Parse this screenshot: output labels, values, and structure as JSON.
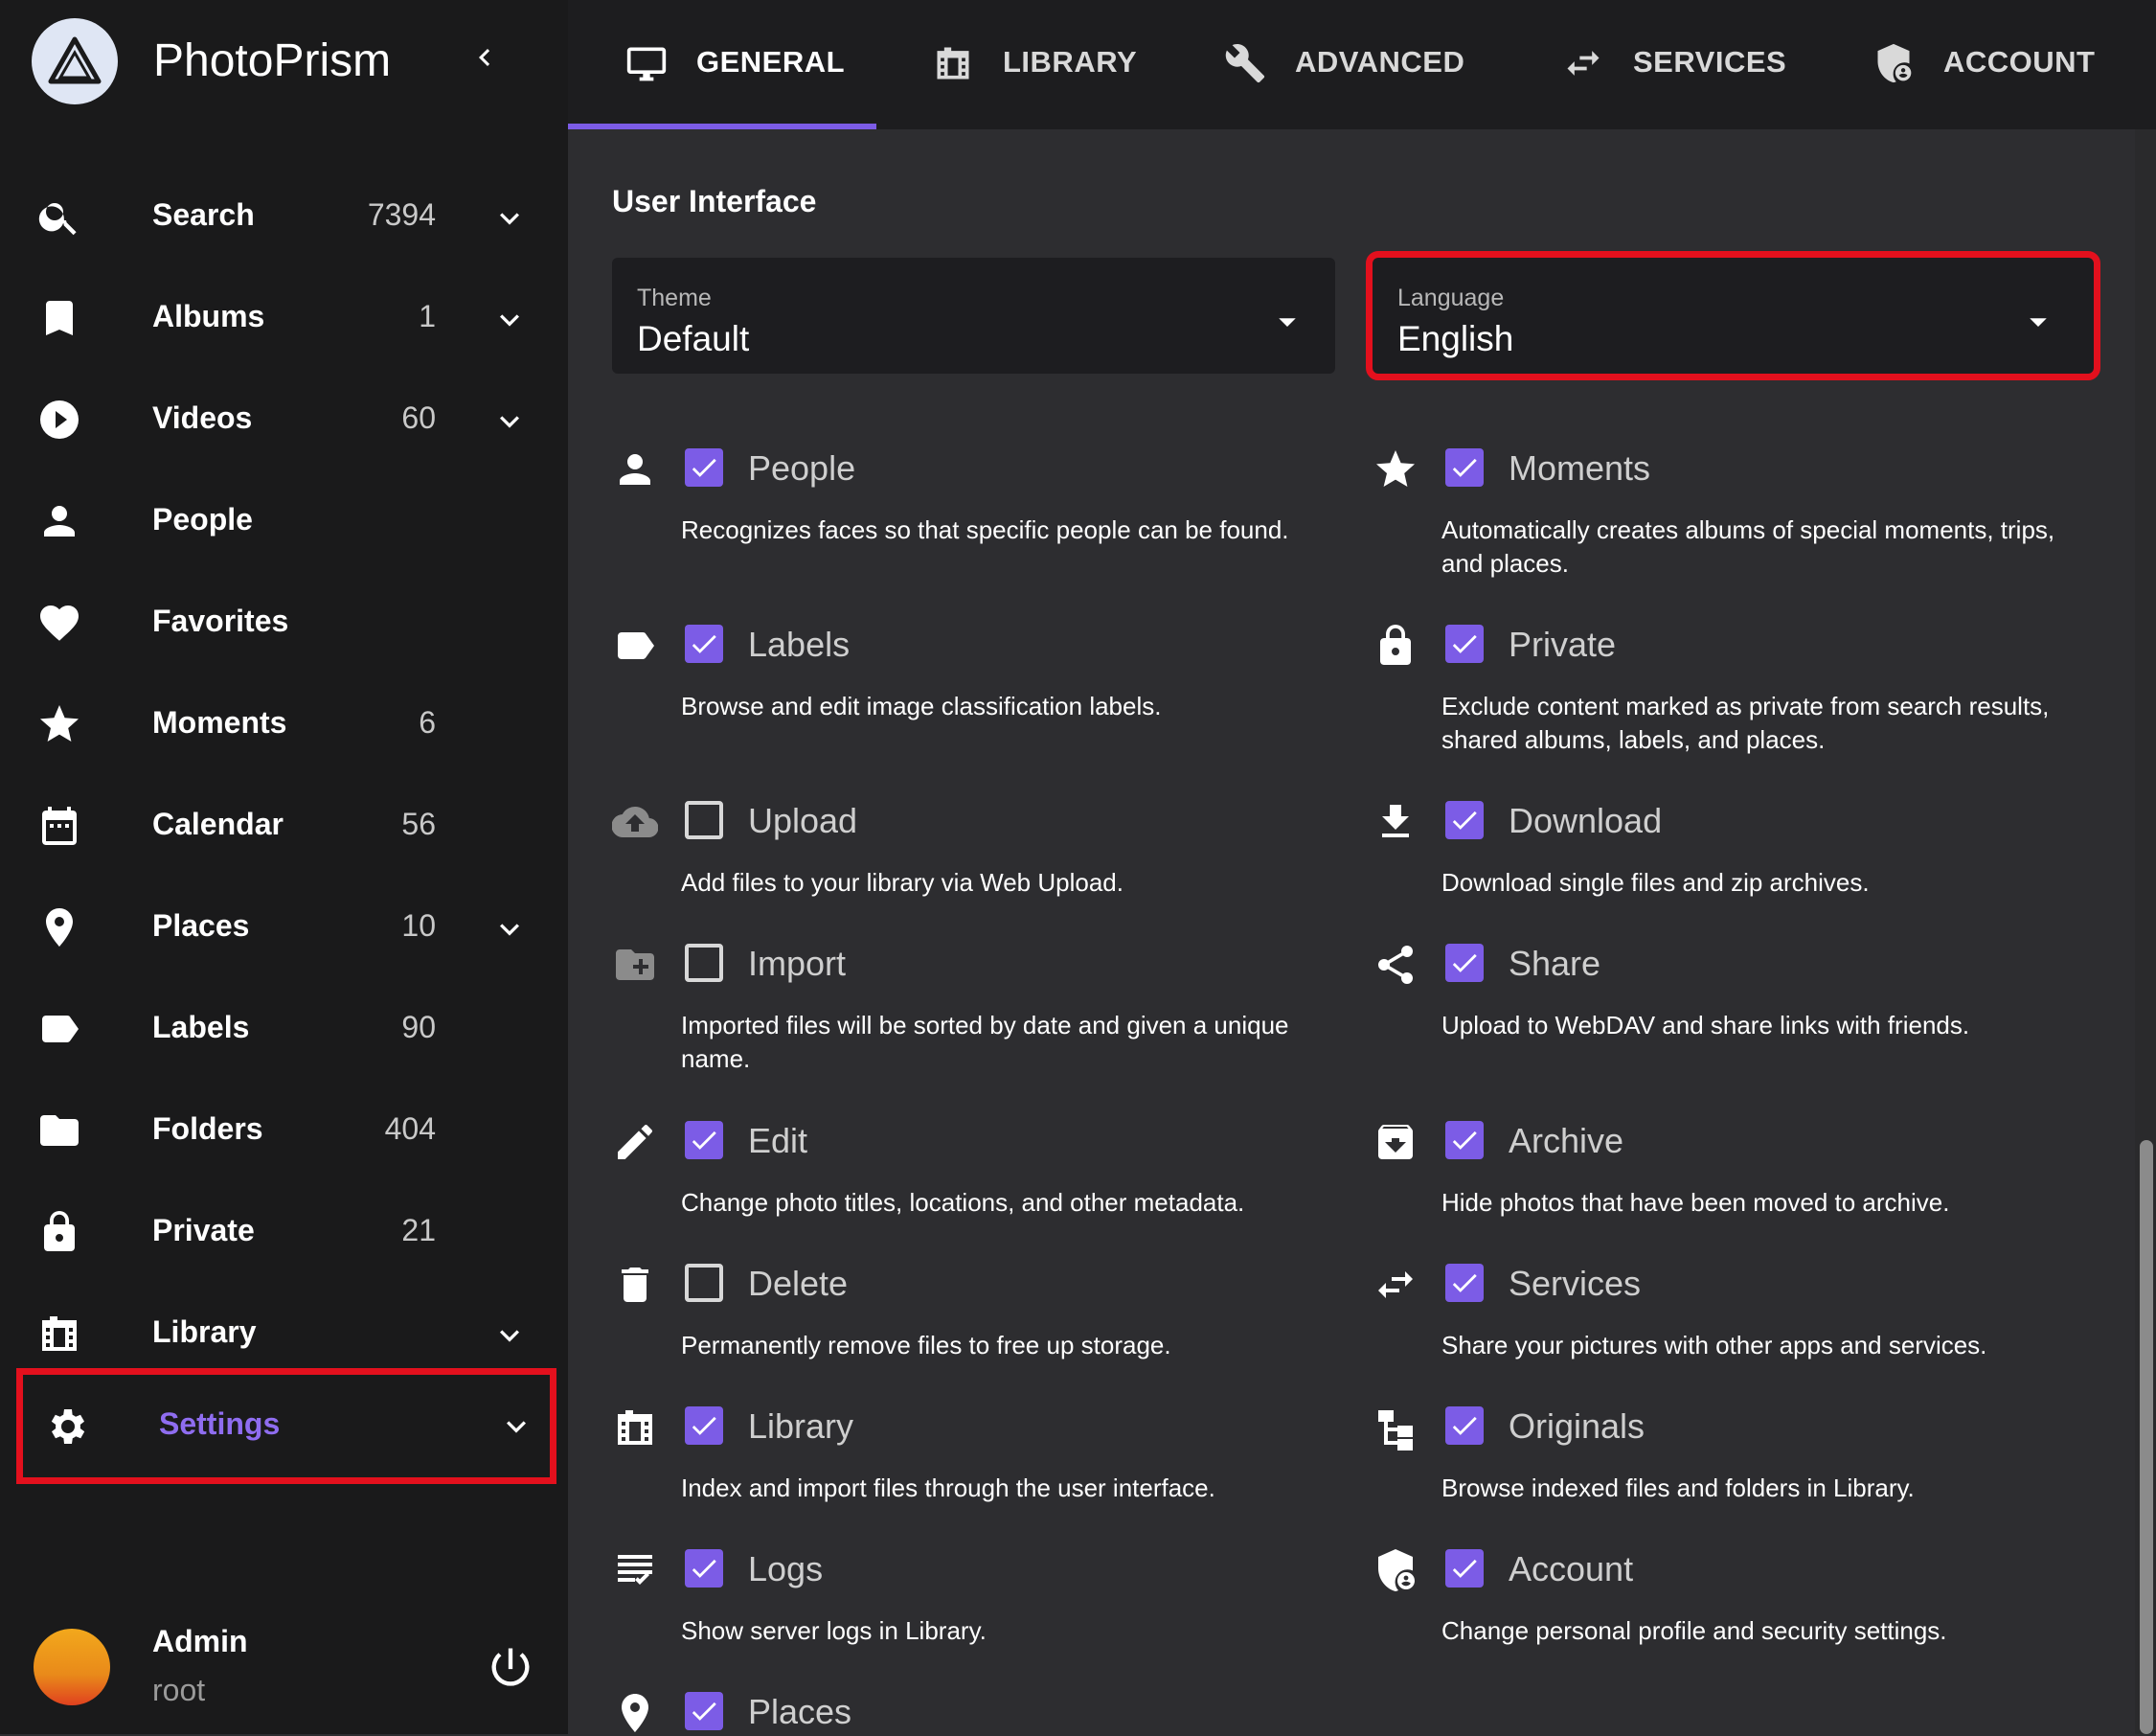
{
  "app": {
    "title": "PhotoPrism",
    "accent": "#7c5ce6",
    "highlight": "#e3101d"
  },
  "sidebar": {
    "items": [
      {
        "label": "Search",
        "count": "7394",
        "icon": "search-icon",
        "chevron": true
      },
      {
        "label": "Albums",
        "count": "1",
        "icon": "bookmark-icon",
        "chevron": true
      },
      {
        "label": "Videos",
        "count": "60",
        "icon": "play-circle-icon",
        "chevron": true
      },
      {
        "label": "People",
        "count": "",
        "icon": "person-icon",
        "chevron": false
      },
      {
        "label": "Favorites",
        "count": "",
        "icon": "heart-icon",
        "chevron": false
      },
      {
        "label": "Moments",
        "count": "6",
        "icon": "star-icon",
        "chevron": false
      },
      {
        "label": "Calendar",
        "count": "56",
        "icon": "calendar-icon",
        "chevron": false
      },
      {
        "label": "Places",
        "count": "10",
        "icon": "map-pin-icon",
        "chevron": true
      },
      {
        "label": "Labels",
        "count": "90",
        "icon": "label-icon",
        "chevron": false
      },
      {
        "label": "Folders",
        "count": "404",
        "icon": "folder-icon",
        "chevron": false
      },
      {
        "label": "Private",
        "count": "21",
        "icon": "lock-icon",
        "chevron": false
      },
      {
        "label": "Library",
        "count": "",
        "icon": "film-library-icon",
        "chevron": true
      },
      {
        "label": "Settings",
        "count": "",
        "icon": "gear-icon",
        "chevron": true,
        "active": true
      }
    ],
    "user": {
      "name": "Admin",
      "login": "root"
    }
  },
  "tabs": [
    {
      "label": "GENERAL",
      "icon": "monitor-icon",
      "active": true
    },
    {
      "label": "LIBRARY",
      "icon": "film-library-icon"
    },
    {
      "label": "ADVANCED",
      "icon": "wrench-icon"
    },
    {
      "label": "SERVICES",
      "icon": "swap-arrows-icon"
    },
    {
      "label": "ACCOUNT",
      "icon": "shield-account-icon"
    }
  ],
  "main": {
    "section_title": "User Interface",
    "theme": {
      "label": "Theme",
      "value": "Default"
    },
    "language": {
      "label": "Language",
      "value": "English"
    },
    "features": [
      {
        "name": "People",
        "desc": "Recognizes faces so that specific people can be found.",
        "checked": true,
        "icon": "person-icon"
      },
      {
        "name": "Moments",
        "desc": "Automatically creates albums of special moments, trips, and places.",
        "checked": true,
        "icon": "star-icon"
      },
      {
        "name": "Labels",
        "desc": "Browse and edit image classification labels.",
        "checked": true,
        "icon": "label-icon"
      },
      {
        "name": "Private",
        "desc": "Exclude content marked as private from search results, shared albums, labels, and places.",
        "checked": true,
        "icon": "lock-icon"
      },
      {
        "name": "Upload",
        "desc": "Add files to your library via Web Upload.",
        "checked": false,
        "icon": "cloud-upload-icon"
      },
      {
        "name": "Download",
        "desc": "Download single files and zip archives.",
        "checked": true,
        "icon": "download-icon"
      },
      {
        "name": "Import",
        "desc": "Imported files will be sorted by date and given a unique name.",
        "checked": false,
        "icon": "folder-plus-icon"
      },
      {
        "name": "Share",
        "desc": "Upload to WebDAV and share links with friends.",
        "checked": true,
        "icon": "share-icon"
      },
      {
        "name": "Edit",
        "desc": "Change photo titles, locations, and other metadata.",
        "checked": true,
        "icon": "pencil-icon"
      },
      {
        "name": "Archive",
        "desc": "Hide photos that have been moved to archive.",
        "checked": true,
        "icon": "archive-icon"
      },
      {
        "name": "Delete",
        "desc": "Permanently remove files to free up storage.",
        "checked": false,
        "icon": "trash-icon"
      },
      {
        "name": "Services",
        "desc": "Share your pictures with other apps and services.",
        "checked": true,
        "icon": "swap-arrows-icon"
      },
      {
        "name": "Library",
        "desc": "Index and import files through the user interface.",
        "checked": true,
        "icon": "film-library-icon"
      },
      {
        "name": "Originals",
        "desc": "Browse indexed files and folders in Library.",
        "checked": true,
        "icon": "file-tree-icon"
      },
      {
        "name": "Logs",
        "desc": "Show server logs in Library.",
        "checked": true,
        "icon": "logs-icon"
      },
      {
        "name": "Account",
        "desc": "Change personal profile and security settings.",
        "checked": true,
        "icon": "shield-account-icon"
      },
      {
        "name": "Places",
        "desc": "",
        "checked": true,
        "icon": "map-pin-icon"
      }
    ]
  }
}
